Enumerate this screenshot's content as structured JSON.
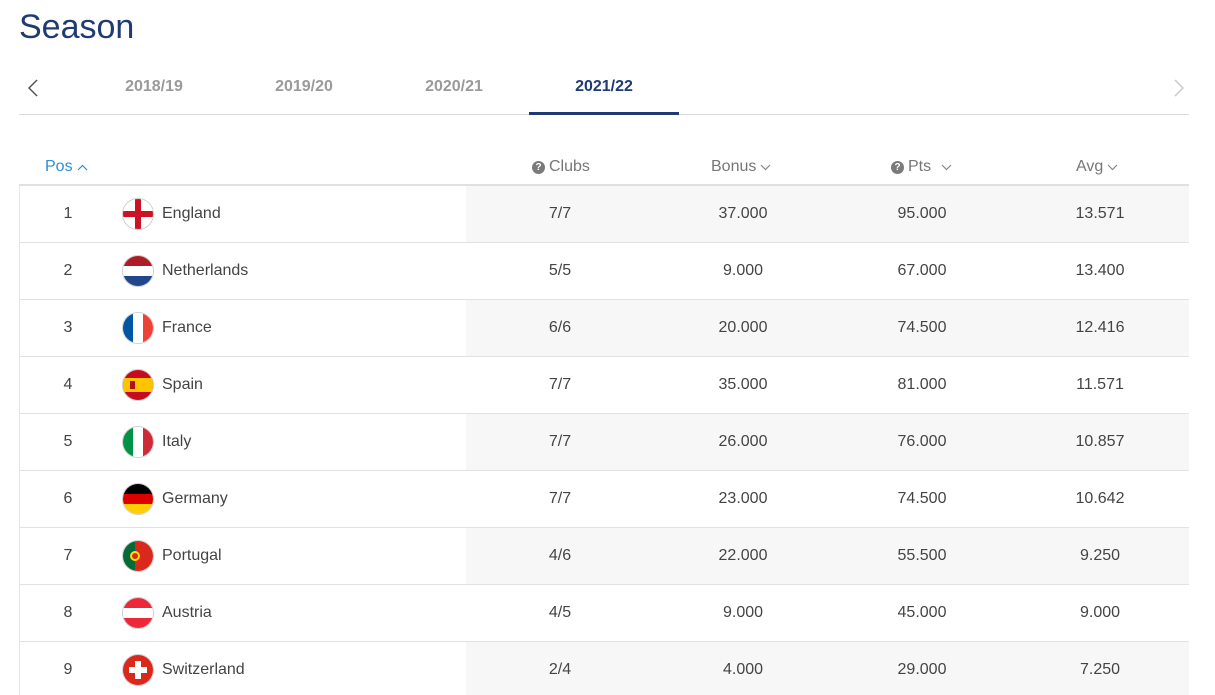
{
  "page": {
    "title": "Season"
  },
  "seasons": {
    "tabs": [
      {
        "label": "2018/19",
        "active": false
      },
      {
        "label": "2019/20",
        "active": false
      },
      {
        "label": "2020/21",
        "active": false
      },
      {
        "label": "2021/22",
        "active": true
      }
    ]
  },
  "table": {
    "headers": {
      "pos": "Pos",
      "clubs": "Clubs",
      "bonus": "Bonus",
      "pts": "Pts",
      "avg": "Avg"
    },
    "rows": [
      {
        "pos": "1",
        "country": "England",
        "flag": "england-flag-icon",
        "clubs": "7/7",
        "bonus": "37.000",
        "pts": "95.000",
        "avg": "13.571"
      },
      {
        "pos": "2",
        "country": "Netherlands",
        "flag": "netherlands-flag-icon",
        "clubs": "5/5",
        "bonus": "9.000",
        "pts": "67.000",
        "avg": "13.400"
      },
      {
        "pos": "3",
        "country": "France",
        "flag": "france-flag-icon",
        "clubs": "6/6",
        "bonus": "20.000",
        "pts": "74.500",
        "avg": "12.416"
      },
      {
        "pos": "4",
        "country": "Spain",
        "flag": "spain-flag-icon",
        "clubs": "7/7",
        "bonus": "35.000",
        "pts": "81.000",
        "avg": "11.571"
      },
      {
        "pos": "5",
        "country": "Italy",
        "flag": "italy-flag-icon",
        "clubs": "7/7",
        "bonus": "26.000",
        "pts": "76.000",
        "avg": "10.857"
      },
      {
        "pos": "6",
        "country": "Germany",
        "flag": "germany-flag-icon",
        "clubs": "7/7",
        "bonus": "23.000",
        "pts": "74.500",
        "avg": "10.642"
      },
      {
        "pos": "7",
        "country": "Portugal",
        "flag": "portugal-flag-icon",
        "clubs": "4/6",
        "bonus": "22.000",
        "pts": "55.500",
        "avg": "9.250"
      },
      {
        "pos": "8",
        "country": "Austria",
        "flag": "austria-flag-icon",
        "clubs": "4/5",
        "bonus": "9.000",
        "pts": "45.000",
        "avg": "9.000"
      },
      {
        "pos": "9",
        "country": "Switzerland",
        "flag": "switzerland-flag-icon",
        "clubs": "2/4",
        "bonus": "4.000",
        "pts": "29.000",
        "avg": "7.250"
      }
    ]
  },
  "colors": {
    "title": "#1f3b73",
    "active_tab": "#1f3b73",
    "sort_active": "#2a8fd6",
    "inactive_tab": "#9a9a9a"
  }
}
